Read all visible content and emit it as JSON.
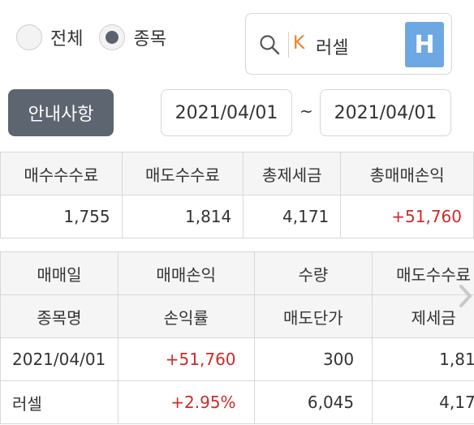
{
  "filter": {
    "options": [
      {
        "label": "전체",
        "checked": false
      },
      {
        "label": "종목",
        "checked": true
      }
    ]
  },
  "search": {
    "market_badge": "K",
    "stock_name": "러셀",
    "h_button": "H"
  },
  "notice_button": "안내사항",
  "date_range": {
    "from": "2021/04/01",
    "separator": "~",
    "to": "2021/04/01"
  },
  "summary": {
    "headers": [
      "매수수수료",
      "매도수수료",
      "총제세금",
      "총매매손익"
    ],
    "values": [
      "1,755",
      "1,814",
      "4,171",
      "+51,760"
    ]
  },
  "detail": {
    "header_row1": [
      "매매일",
      "매매손익",
      "수량",
      "매도수수료"
    ],
    "header_row2": [
      "종목명",
      "손익률",
      "매도단가",
      "제세금"
    ],
    "rows": [
      [
        "2021/04/01",
        "+51,760",
        "300",
        "1,81"
      ],
      [
        "러셀",
        "+2.95%",
        "6,045",
        "4,17"
      ]
    ]
  },
  "colors": {
    "profit_red": "#cc2b2b",
    "market_badge_orange": "#f07d2e",
    "h_button_blue": "#6ea8e2",
    "notice_button_gray": "#5d6570"
  },
  "icons": {
    "search": "magnifier",
    "scroll": "chevron-right"
  }
}
